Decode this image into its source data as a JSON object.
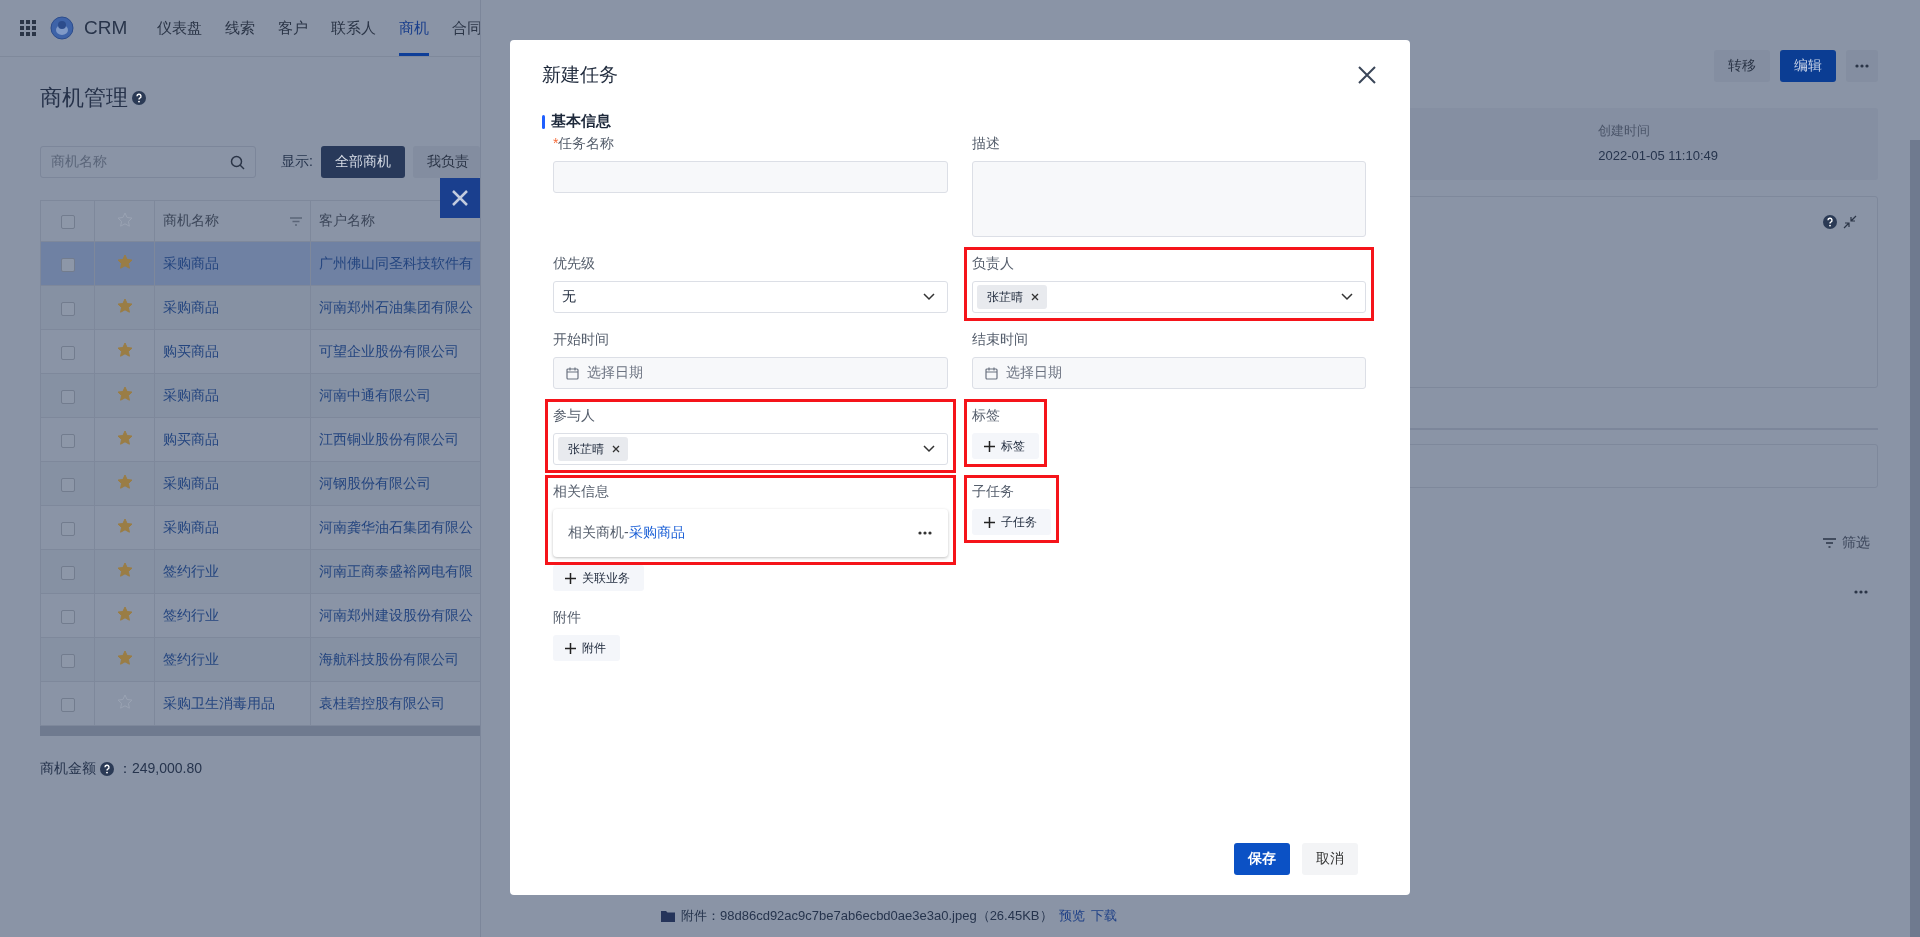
{
  "nav": {
    "brand": "CRM",
    "items": [
      {
        "label": "仪表盘",
        "selected": false
      },
      {
        "label": "线索",
        "selected": false
      },
      {
        "label": "客户",
        "selected": false
      },
      {
        "label": "联系人",
        "selected": false
      },
      {
        "label": "商机",
        "selected": true
      },
      {
        "label": "合同",
        "selected": false
      }
    ]
  },
  "list": {
    "title": "商机管理",
    "search": {
      "placeholder": "商机名称"
    },
    "filter_label": "显示:",
    "filters": [
      {
        "label": "全部商机",
        "selected": true
      },
      {
        "label": "我负责",
        "selected": false
      }
    ],
    "table": {
      "columns": [
        "商机名称",
        "客户名称"
      ],
      "all_checked": false,
      "rows": [
        {
          "checked": false,
          "starred": true,
          "selected": true,
          "name": "采购商品",
          "customer": "广州佛山同圣科技软件有"
        },
        {
          "checked": false,
          "starred": true,
          "selected": false,
          "name": "采购商品",
          "customer": "河南郑州石油集团有限公"
        },
        {
          "checked": false,
          "starred": true,
          "selected": false,
          "name": "购买商品",
          "customer": "可望企业股份有限公司"
        },
        {
          "checked": false,
          "starred": true,
          "selected": false,
          "name": "采购商品",
          "customer": "河南中通有限公司"
        },
        {
          "checked": false,
          "starred": true,
          "selected": false,
          "name": "购买商品",
          "customer": "江西铜业股份有限公司"
        },
        {
          "checked": false,
          "starred": true,
          "selected": false,
          "name": "采购商品",
          "customer": "河钢股份有限公司"
        },
        {
          "checked": false,
          "starred": true,
          "selected": false,
          "name": "采购商品",
          "customer": "河南龚华油石集团有限公"
        },
        {
          "checked": false,
          "starred": true,
          "selected": false,
          "name": "签约行业",
          "customer": "河南正商泰盛裕网电有限"
        },
        {
          "checked": false,
          "starred": true,
          "selected": false,
          "name": "签约行业",
          "customer": "河南郑州建设股份有限公"
        },
        {
          "checked": false,
          "starred": true,
          "selected": false,
          "name": "签约行业",
          "customer": "海航科技股份有限公司"
        },
        {
          "checked": false,
          "starred": false,
          "selected": false,
          "name": "采购卫生消毒用品",
          "customer": "袁桂碧控股有限公司"
        }
      ]
    },
    "summary": {
      "label": "商机金额",
      "value": "：249,000.80"
    }
  },
  "detail": {
    "buttons": [
      {
        "label": "转移",
        "kind": "secondary"
      },
      {
        "label": "编辑",
        "kind": "primary"
      }
    ],
    "created": {
      "label": "创建时间",
      "value": "2022-01-05 11:10:49"
    },
    "filter": "筛选",
    "attachment": {
      "text": "附件：98d86cd92ac9c7be7ab6ecbd0ae3e3a0.jpeg（26.45KB）",
      "links": [
        "预览",
        "下载"
      ]
    }
  },
  "dialog": {
    "title": "新建任务",
    "section": "基本信息",
    "fields": [
      {
        "kind": "text",
        "label": "任务名称",
        "required_mark": "*",
        "highlighted": false
      },
      {
        "kind": "textarea",
        "label": "描述",
        "highlighted": false
      },
      {
        "kind": "select",
        "label": "优先级",
        "value": "无",
        "highlighted": false
      },
      {
        "kind": "tags",
        "label": "负责人",
        "tags": [
          "张芷晴"
        ],
        "highlighted": true
      },
      {
        "kind": "date",
        "label": "开始时间",
        "placeholder": "选择日期",
        "highlighted": false
      },
      {
        "kind": "date",
        "label": "结束时间",
        "placeholder": "选择日期",
        "highlighted": false
      },
      {
        "kind": "tags",
        "label": "参与人",
        "tags": [
          "张芷晴"
        ],
        "highlighted": true
      },
      {
        "kind": "add",
        "label": "标签",
        "button": "标签",
        "highlighted": true
      },
      {
        "kind": "related",
        "label": "相关信息",
        "prefix": "相关商机-",
        "link": "采购商品",
        "button": "关联业务",
        "highlighted": true
      },
      {
        "kind": "add",
        "label": "子任务",
        "button": "子任务",
        "highlighted": true
      },
      {
        "kind": "add",
        "label": "附件",
        "button": "附件",
        "highlighted": false
      }
    ],
    "buttons": [
      {
        "label": "保存",
        "kind": "primary"
      },
      {
        "label": "取消",
        "kind": "secondary"
      }
    ]
  }
}
